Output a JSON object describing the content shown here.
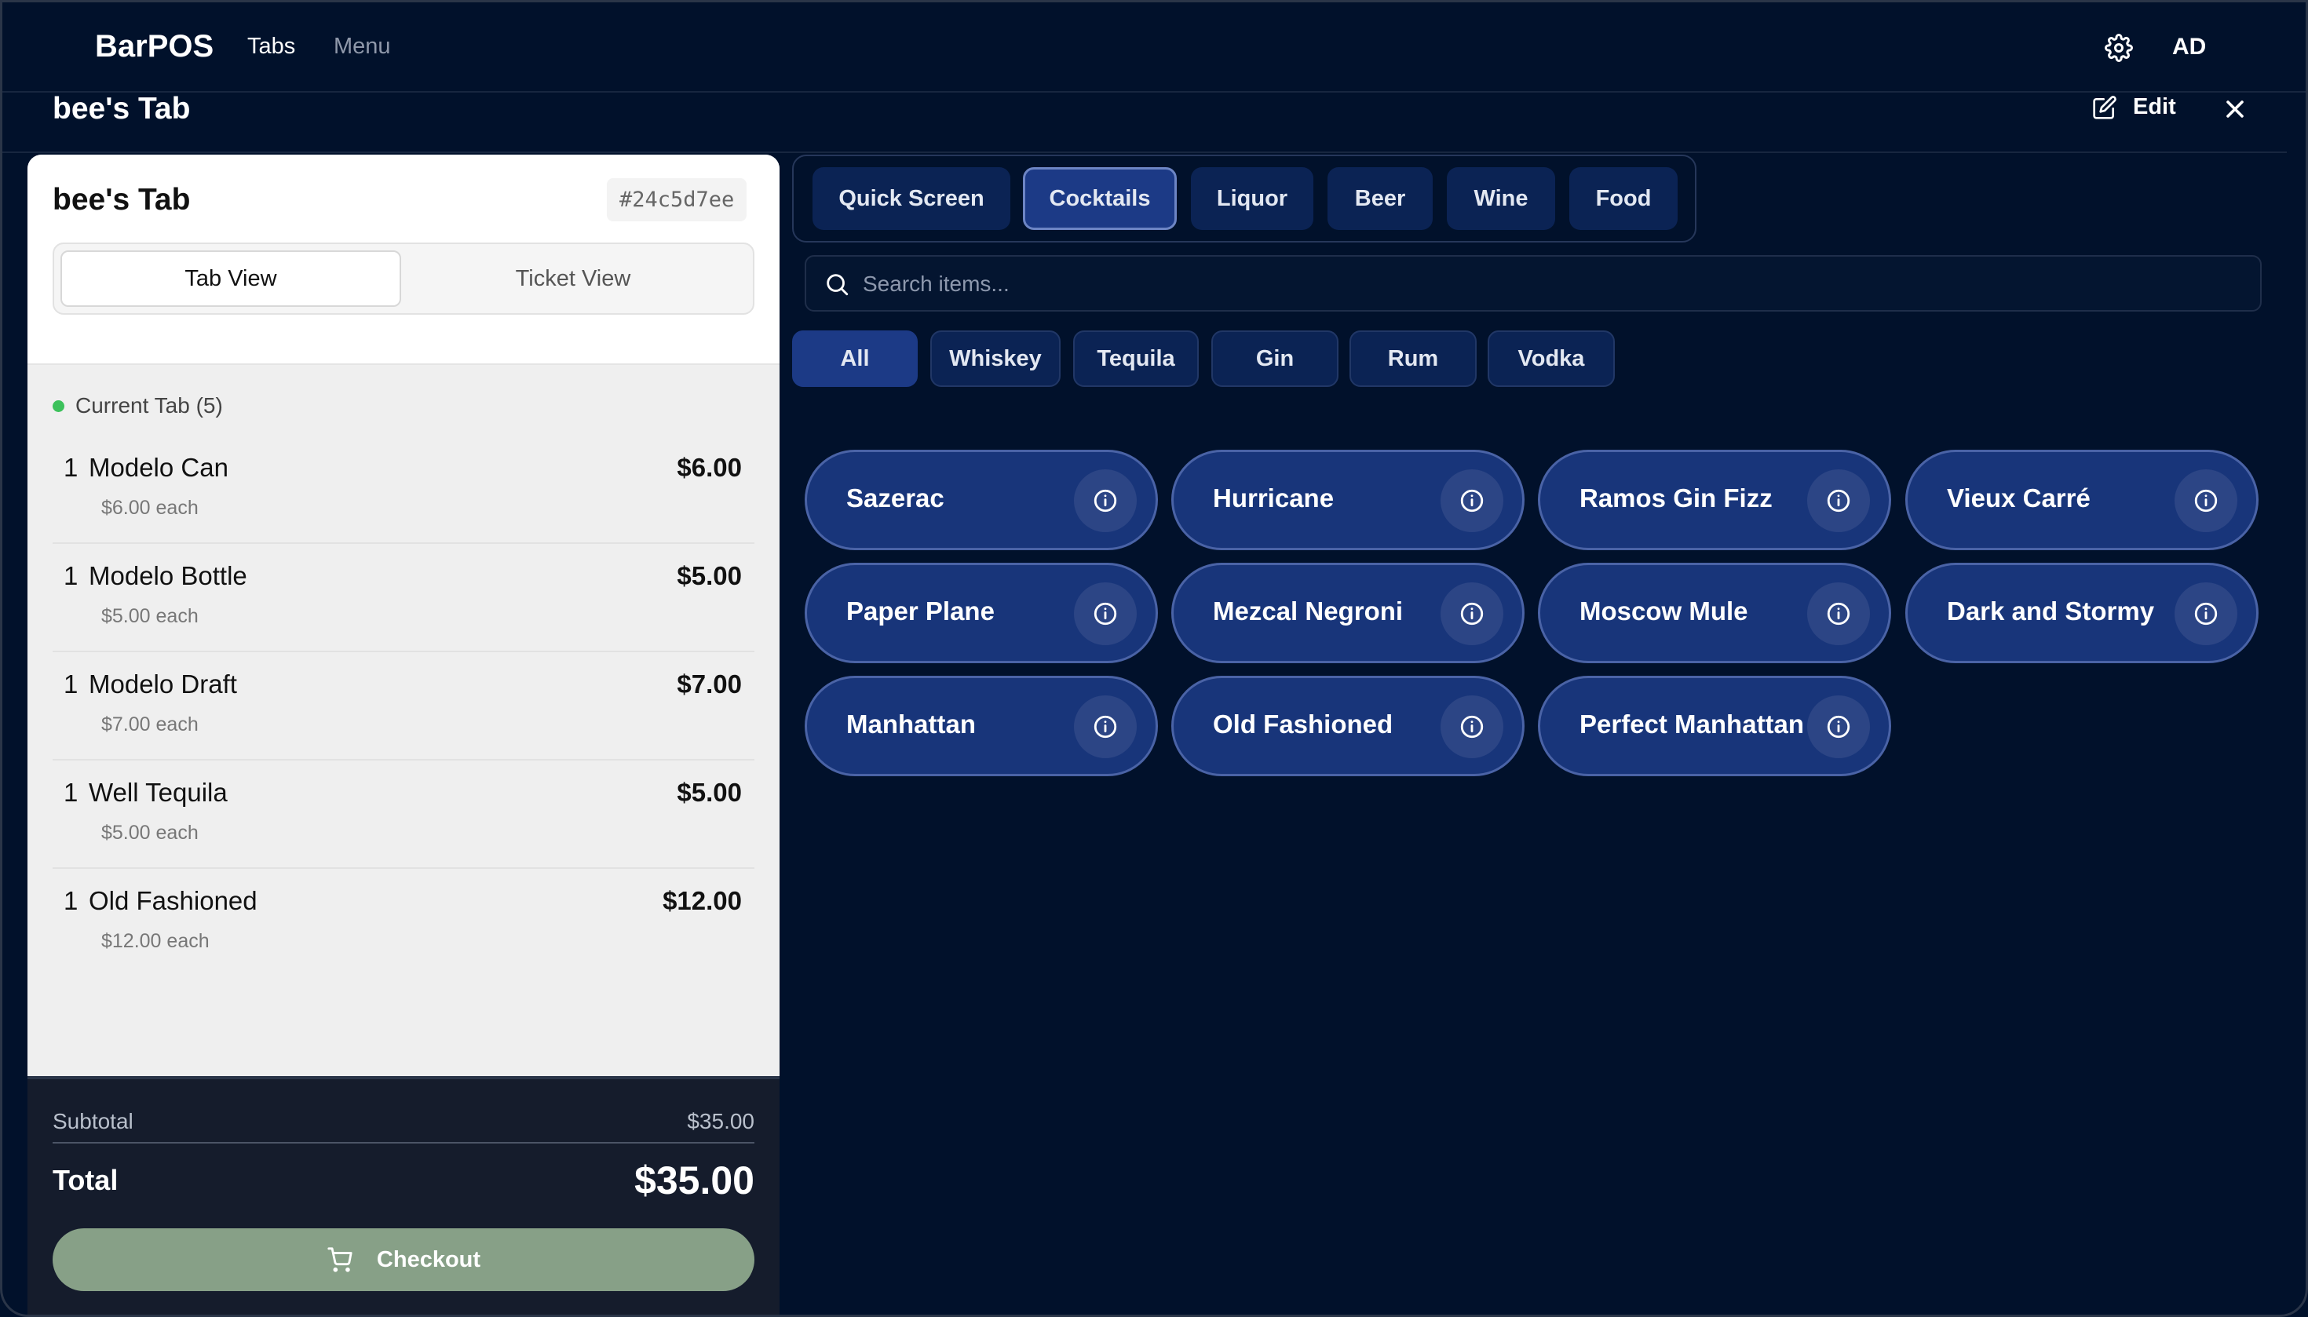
{
  "app": {
    "brand": "BarPOS",
    "nav": [
      "Tabs",
      "Menu"
    ],
    "user_initials": "AD"
  },
  "tab_header": {
    "title": "bee's Tab",
    "edit_label": "Edit"
  },
  "panel": {
    "title": "bee's Tab",
    "tab_id": "#24c5d7ee",
    "views": [
      "Tab View",
      "Ticket View"
    ],
    "section_label": "Current Tab (5)",
    "items": [
      {
        "qty": "1",
        "name": "Modelo Can",
        "price": "$6.00",
        "each": "$6.00 each"
      },
      {
        "qty": "1",
        "name": "Modelo Bottle",
        "price": "$5.00",
        "each": "$5.00 each"
      },
      {
        "qty": "1",
        "name": "Modelo Draft",
        "price": "$7.00",
        "each": "$7.00 each"
      },
      {
        "qty": "1",
        "name": "Well Tequila",
        "price": "$5.00",
        "each": "$5.00 each"
      },
      {
        "qty": "1",
        "name": "Old Fashioned",
        "price": "$12.00",
        "each": "$12.00 each"
      }
    ],
    "subtotal_label": "Subtotal",
    "subtotal_value": "$35.00",
    "total_label": "Total",
    "total_value": "$35.00",
    "checkout_label": "Checkout"
  },
  "categories": [
    "Quick Screen",
    "Cocktails",
    "Liquor",
    "Beer",
    "Wine",
    "Food"
  ],
  "active_category": "Cocktails",
  "search": {
    "placeholder": "Search items..."
  },
  "subcategories": [
    "All",
    "Whiskey",
    "Tequila",
    "Gin",
    "Rum",
    "Vodka"
  ],
  "active_subcategory": "All",
  "menu_items": [
    "Sazerac",
    "Hurricane",
    "Ramos Gin Fizz",
    "Vieux Carré",
    "Paper Plane",
    "Mezcal Negroni",
    "Moscow Mule",
    "Dark and Stormy",
    "Manhattan",
    "Old Fashioned",
    "Perfect Manhattan"
  ],
  "colors": {
    "background": "#01112b",
    "accent": "#1c3a86",
    "item_button": "#18357a",
    "checkout": "#87a087",
    "status_dot": "#3cc15b"
  }
}
